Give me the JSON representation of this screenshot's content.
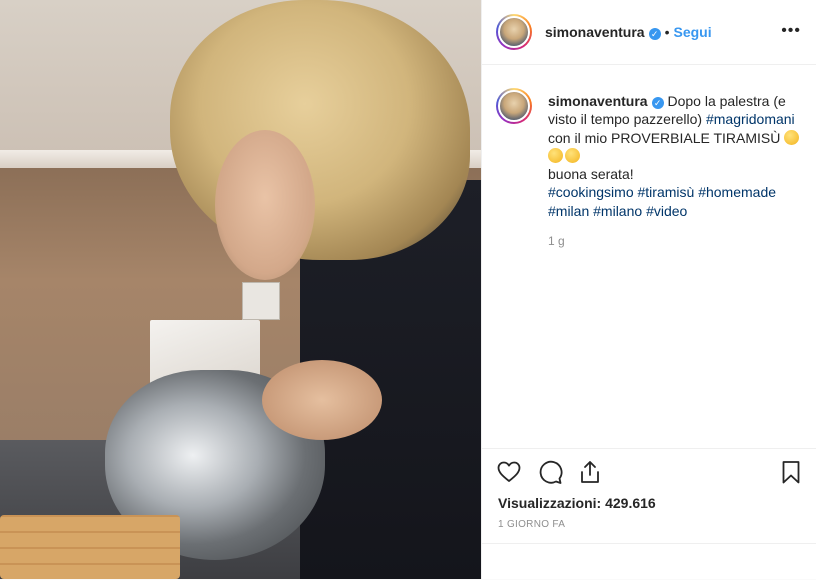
{
  "post": {
    "username": "simonaventura",
    "verified_glyph": "✓",
    "dot": "•",
    "follow_label": "Segui",
    "more_label": "•••"
  },
  "caption": {
    "username": "simonaventura",
    "text_1": "Dopo la palestra (e visto il tempo pazzerello)",
    "hashtag_1": "#magridomani",
    "text_2": "con il mio PROVERBIALE TIRAMISÙ",
    "text_3": "buona serata!",
    "hashtags": [
      "#cookingsimo",
      "#tiramisù",
      "#homemade",
      "#milan",
      "#milano",
      "#video"
    ],
    "time": "1 g"
  },
  "stats": {
    "views_label": "Visualizzazioni:",
    "views_count": "429.616",
    "date": "1 giorno fa"
  },
  "icons": {
    "like": "heart-icon",
    "comment": "comment-icon",
    "share": "share-icon",
    "save": "bookmark-icon",
    "verified": "verified-badge-icon",
    "emoji": [
      "savoring-food-emoji",
      "savoring-food-emoji",
      "grinning-squinting-emoji"
    ]
  },
  "colors": {
    "link": "#3897f0",
    "hashtag": "#003569",
    "muted": "#8e8e8e",
    "text": "#262626"
  }
}
